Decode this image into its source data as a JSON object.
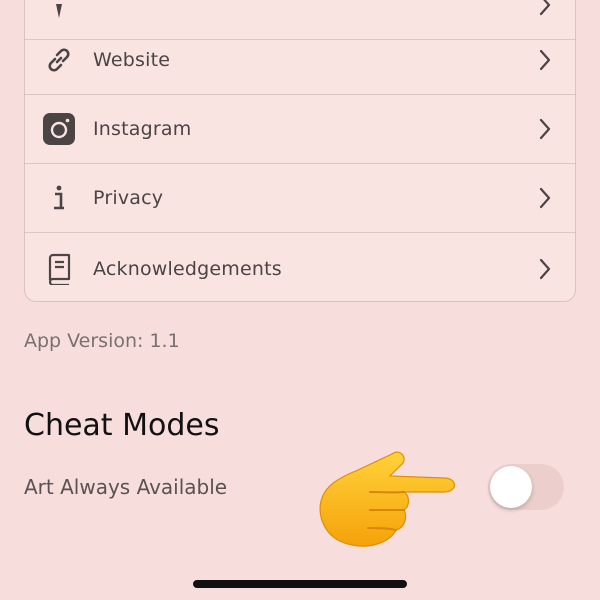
{
  "settings_list": {
    "items": [
      {
        "label": "",
        "icon": "location-pin-icon"
      },
      {
        "label": "Website",
        "icon": "link-icon"
      },
      {
        "label": "Instagram",
        "icon": "instagram-icon"
      },
      {
        "label": "Privacy",
        "icon": "info-icon"
      },
      {
        "label": "Acknowledgements",
        "icon": "book-icon"
      }
    ]
  },
  "app_version": "App Version: 1.1",
  "cheat_modes": {
    "title": "Cheat Modes",
    "toggle_label": "Art Always Available",
    "toggle_on": false
  },
  "colors": {
    "background": "#f7dedc",
    "card": "#fae4e2",
    "toggle_track": "#eccfcd"
  }
}
